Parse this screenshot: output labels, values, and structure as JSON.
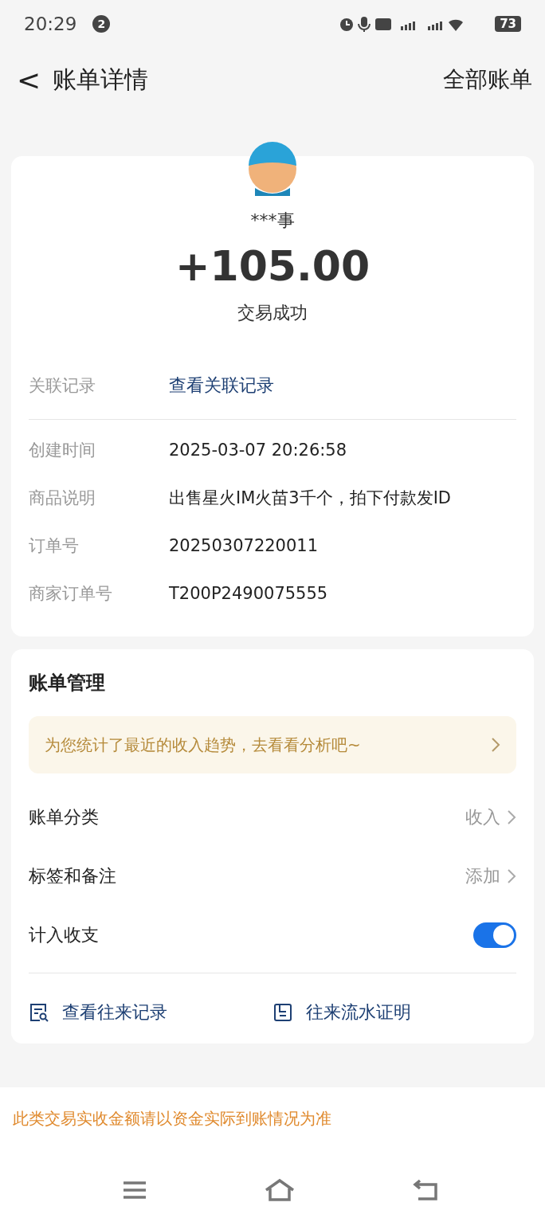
{
  "status_bar": {
    "time": "20:29",
    "notification_count": "2",
    "battery": "73"
  },
  "header": {
    "back": "<",
    "title": "账单详情",
    "action": "全部账单"
  },
  "transaction": {
    "counterparty": "***事",
    "amount": "+105.00",
    "status": "交易成功"
  },
  "related": {
    "label": "关联记录",
    "link": "查看关联记录"
  },
  "details": [
    {
      "label": "创建时间",
      "value": "2025-03-07 20:26:58"
    },
    {
      "label": "商品说明",
      "value": "出售星火IM火苗3千个，拍下付款发ID"
    },
    {
      "label": "订单号",
      "value": "20250307220011"
    },
    {
      "label": "商家订单号",
      "value": "T200P2490075555"
    }
  ],
  "management": {
    "title": "账单管理",
    "banner": "为您统计了最近的收入趋势，去看看分析吧~",
    "rows": [
      {
        "kind": "link",
        "label": "账单分类",
        "value": "收入"
      },
      {
        "kind": "link",
        "label": "标签和备注",
        "value": "添加"
      },
      {
        "kind": "toggle",
        "label": "计入收支",
        "on": true
      }
    ],
    "actions": [
      {
        "kind": "records",
        "label": "查看往来记录"
      },
      {
        "kind": "proof",
        "label": "往来流水证明"
      }
    ]
  },
  "notice": "此类交易实收金额请以资金实际到账情况为准"
}
